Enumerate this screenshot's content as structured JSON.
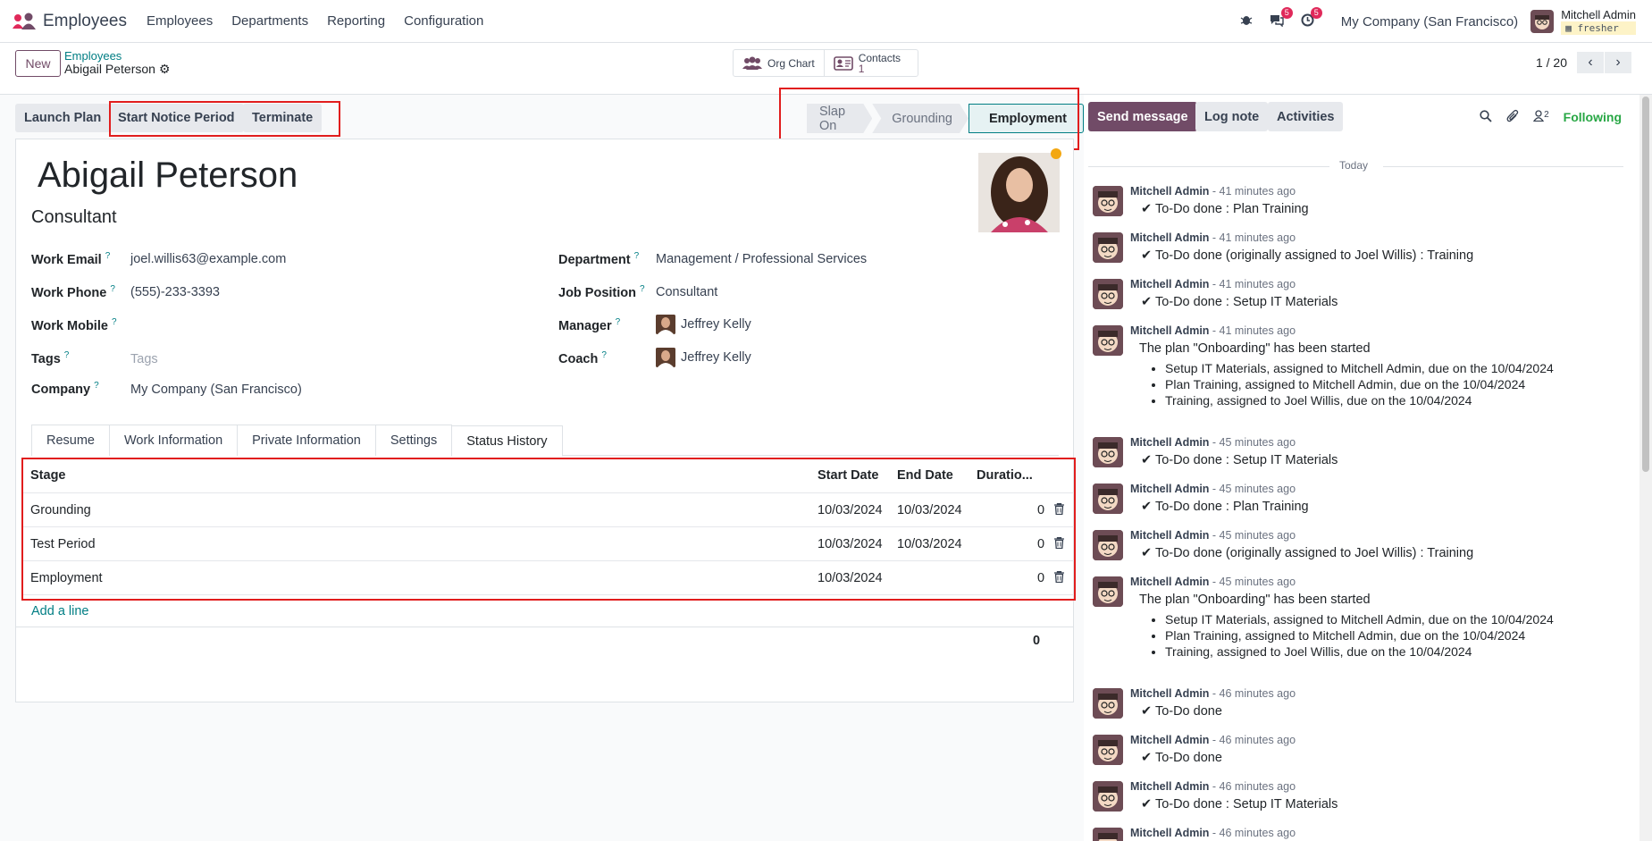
{
  "navbar": {
    "app_name": "Employees",
    "menu": [
      "Employees",
      "Departments",
      "Reporting",
      "Configuration"
    ],
    "chat_badge": "5",
    "activity_badge": "5",
    "company": "My Company (San Francisco)",
    "user_name": "Mitchell Admin",
    "user_db": "fresher"
  },
  "control_panel": {
    "new_label": "New",
    "breadcrumb_parent": "Employees",
    "breadcrumb_current": "Abigail Peterson",
    "org_chart_label": "Org Chart",
    "contacts_label": "Contacts",
    "contacts_count": "1",
    "pager": "1 / 20"
  },
  "actions": {
    "launch_plan": "Launch Plan",
    "start_notice": "Start Notice Period",
    "terminate": "Terminate"
  },
  "statusbar": [
    "Slap On",
    "Grounding",
    "Employment"
  ],
  "employee": {
    "name": "Abigail Peterson",
    "job_title": "Consultant",
    "fields_left": [
      {
        "label": "Work Email",
        "value": "joel.willis63@example.com"
      },
      {
        "label": "Work Phone",
        "value": "(555)-233-3393"
      },
      {
        "label": "Work Mobile",
        "value": ""
      },
      {
        "label": "Tags",
        "value": "Tags"
      },
      {
        "label": "Company",
        "value": "My Company (San Francisco)"
      }
    ],
    "fields_right": [
      {
        "label": "Department",
        "value": "Management / Professional Services"
      },
      {
        "label": "Job Position",
        "value": "Consultant"
      },
      {
        "label": "Manager",
        "value": "Jeffrey Kelly"
      },
      {
        "label": "Coach",
        "value": "Jeffrey Kelly"
      }
    ]
  },
  "tabs": [
    "Resume",
    "Work Information",
    "Private Information",
    "Settings",
    "Status History"
  ],
  "history": {
    "columns": [
      "Stage",
      "Start Date",
      "End Date",
      "Duratio..."
    ],
    "rows": [
      {
        "stage": "Grounding",
        "start": "10/03/2024",
        "end": "10/03/2024",
        "duration": "0"
      },
      {
        "stage": "Test Period",
        "start": "10/03/2024",
        "end": "10/03/2024",
        "duration": "0"
      },
      {
        "stage": "Employment",
        "start": "10/03/2024",
        "end": "",
        "duration": "0"
      }
    ],
    "add_line": "Add a line",
    "total": "0"
  },
  "chatter": {
    "send_message": "Send message",
    "log_note": "Log note",
    "activities": "Activities",
    "followers_count": "2",
    "following": "Following",
    "today": "Today",
    "messages": [
      {
        "author": "Mitchell Admin",
        "time": "- 41 minutes ago",
        "body": "To-Do done : Plan Training"
      },
      {
        "author": "Mitchell Admin",
        "time": "- 41 minutes ago",
        "body": "To-Do done (originally assigned to Joel Willis) : Training"
      },
      {
        "author": "Mitchell Admin",
        "time": "- 41 minutes ago",
        "body": "To-Do done : Setup IT Materials"
      },
      {
        "author": "Mitchell Admin",
        "time": "- 41 minutes ago",
        "body": "The plan \"Onboarding\" has been started",
        "items": [
          "Setup IT Materials, assigned to Mitchell Admin, due on the 10/04/2024",
          "Plan Training, assigned to Mitchell Admin, due on the 10/04/2024",
          "Training, assigned to Joel Willis, due on the 10/04/2024"
        ]
      },
      {
        "author": "Mitchell Admin",
        "time": "- 45 minutes ago",
        "body": "To-Do done : Setup IT Materials"
      },
      {
        "author": "Mitchell Admin",
        "time": "- 45 minutes ago",
        "body": "To-Do done : Plan Training"
      },
      {
        "author": "Mitchell Admin",
        "time": "- 45 minutes ago",
        "body": "To-Do done (originally assigned to Joel Willis) : Training"
      },
      {
        "author": "Mitchell Admin",
        "time": "- 45 minutes ago",
        "body": "The plan \"Onboarding\" has been started",
        "items": [
          "Setup IT Materials, assigned to Mitchell Admin, due on the 10/04/2024",
          "Plan Training, assigned to Mitchell Admin, due on the 10/04/2024",
          "Training, assigned to Joel Willis, due on the 10/04/2024"
        ]
      },
      {
        "author": "Mitchell Admin",
        "time": "- 46 minutes ago",
        "body": "To-Do done"
      },
      {
        "author": "Mitchell Admin",
        "time": "- 46 minutes ago",
        "body": "To-Do done"
      },
      {
        "author": "Mitchell Admin",
        "time": "- 46 minutes ago",
        "body": "To-Do done : Setup IT Materials"
      },
      {
        "author": "Mitchell Admin",
        "time": "- 46 minutes ago",
        "body": ""
      }
    ]
  },
  "colors": {
    "brand": "#714b67",
    "link": "#017e84",
    "highlight": "#e11d1d"
  }
}
